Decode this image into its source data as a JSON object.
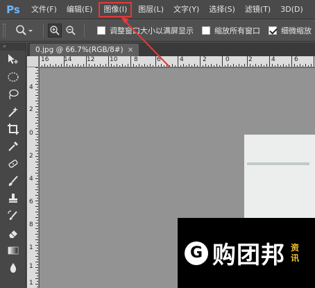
{
  "menubar": {
    "logo": "Ps",
    "items": [
      {
        "label": "文件(F)"
      },
      {
        "label": "编辑(E)"
      },
      {
        "label": "图像(I)",
        "highlighted": true
      },
      {
        "label": "图层(L)"
      },
      {
        "label": "文字(Y)"
      },
      {
        "label": "选择(S)"
      },
      {
        "label": "滤镜(T)"
      },
      {
        "label": "3D(D)"
      }
    ]
  },
  "options": {
    "resize_window_label": "调整窗口大小以满屏显示",
    "resize_window_checked": false,
    "zoom_all_label": "缩放所有窗口",
    "zoom_all_checked": false,
    "scrubby_zoom_label": "细微缩放",
    "scrubby_zoom_checked": true
  },
  "document": {
    "tab_title": "0.jpg @ 66.7%(RGB/8#)",
    "close_glyph": "×"
  },
  "rulers": {
    "horizontal": [
      "16",
      "14",
      "12",
      "10",
      "8",
      "6",
      "4",
      "2",
      "0",
      "2",
      "4",
      "6"
    ],
    "vertical": [
      "4",
      "2",
      "0",
      "2",
      "4",
      "6",
      "8",
      "1",
      "1",
      "1"
    ]
  },
  "watermark": {
    "logo_letter": "G",
    "text": "购团邦",
    "side_text": "资讯"
  },
  "colors": {
    "highlight": "#e23a3a",
    "canvas_bg": "#939393",
    "ps_blue": "#6fb6ff"
  }
}
